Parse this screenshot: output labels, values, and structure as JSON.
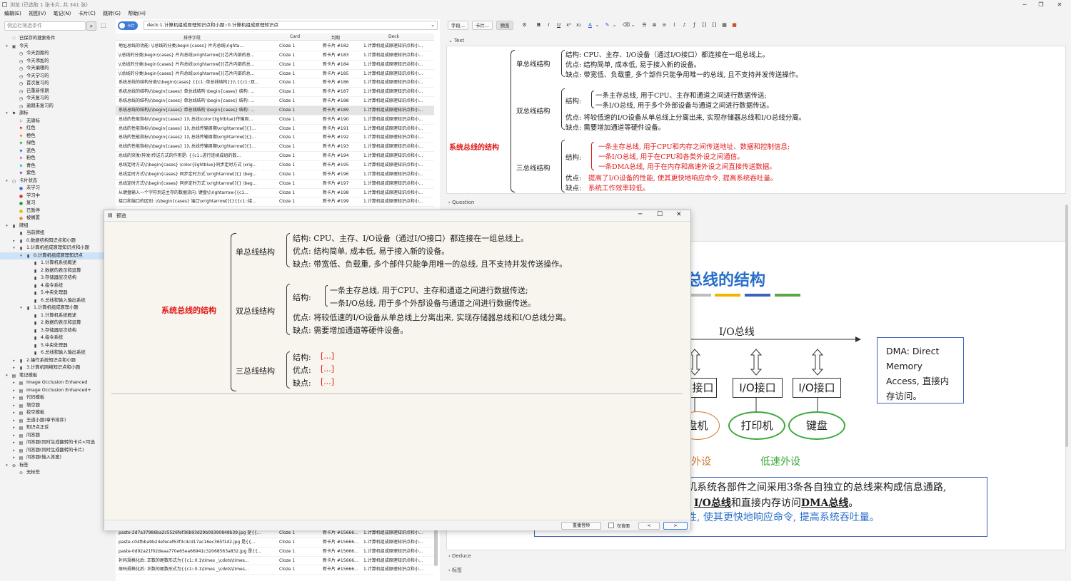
{
  "window": {
    "title": "浏览 (已选取 1 张卡片, 共 341 张)"
  },
  "menu": [
    "编辑(E)",
    "视图(V)",
    "笔记(N)",
    "卡片(C)",
    "跳转(G)",
    "帮助(H)"
  ],
  "sidebar": {
    "search_placeholder": "侧边栏筛选条件",
    "tree": [
      {
        "label": "已保存的搜索条件",
        "icon": "heart-icon",
        "level": 0,
        "arrow": ""
      },
      {
        "label": "今天",
        "icon": "calendar-icon",
        "level": 0,
        "arrow": "▾"
      },
      {
        "label": "今天到期的",
        "icon": "clock-icon",
        "level": 1,
        "arrow": ""
      },
      {
        "label": "今天添加的",
        "icon": "clock-icon",
        "level": 1,
        "arrow": ""
      },
      {
        "label": "今天编辑的",
        "icon": "clock-icon",
        "level": 1,
        "arrow": ""
      },
      {
        "label": "今天学习的",
        "icon": "clock-icon",
        "level": 1,
        "arrow": ""
      },
      {
        "label": "首次复习的",
        "icon": "clock-icon",
        "level": 1,
        "arrow": ""
      },
      {
        "label": "已重新排期",
        "icon": "clock-icon",
        "level": 1,
        "arrow": ""
      },
      {
        "label": "今天复习的",
        "icon": "clock-icon",
        "level": 1,
        "arrow": ""
      },
      {
        "label": "逾期未复习的",
        "icon": "clock-icon",
        "level": 1,
        "arrow": ""
      },
      {
        "label": "旗标",
        "icon": "flag-icon",
        "level": 0,
        "arrow": "▾"
      },
      {
        "label": "无旗标",
        "icon": "flag-off-icon",
        "level": 1,
        "arrow": ""
      },
      {
        "label": "红色",
        "icon": "flag-red-icon",
        "level": 1,
        "arrow": ""
      },
      {
        "label": "橙色",
        "icon": "flag-orange-icon",
        "level": 1,
        "arrow": ""
      },
      {
        "label": "绿色",
        "icon": "flag-green-icon",
        "level": 1,
        "arrow": ""
      },
      {
        "label": "蓝色",
        "icon": "flag-blue-icon",
        "level": 1,
        "arrow": ""
      },
      {
        "label": "粉色",
        "icon": "flag-pink-icon",
        "level": 1,
        "arrow": ""
      },
      {
        "label": "青色",
        "icon": "flag-cyan-icon",
        "level": 1,
        "arrow": ""
      },
      {
        "label": "紫色",
        "icon": "flag-purple-icon",
        "level": 1,
        "arrow": ""
      },
      {
        "label": "卡片状态",
        "icon": "circle-icon",
        "level": 0,
        "arrow": "▾"
      },
      {
        "label": "未学习",
        "icon": "dot-blue-icon",
        "level": 1,
        "arrow": ""
      },
      {
        "label": "学习中",
        "icon": "dot-red-icon",
        "level": 1,
        "arrow": ""
      },
      {
        "label": "复习",
        "icon": "dot-green-icon",
        "level": 1,
        "arrow": ""
      },
      {
        "label": "已暂停",
        "icon": "dot-yellow-icon",
        "level": 1,
        "arrow": ""
      },
      {
        "label": "被搁置",
        "icon": "dot-orange-icon",
        "level": 1,
        "arrow": ""
      },
      {
        "label": "牌组",
        "icon": "deck-icon",
        "level": 0,
        "arrow": "▾"
      },
      {
        "label": "当前牌组",
        "icon": "deck-icon",
        "level": 1,
        "arrow": ""
      },
      {
        "label": "0.数据结构知识点和小题",
        "icon": "deck-icon",
        "level": 1,
        "arrow": "▸"
      },
      {
        "label": "1.计算机组成原理知识点和小题",
        "icon": "deck-icon",
        "level": 1,
        "arrow": "▾"
      },
      {
        "label": "0.计算机组成原理知识点",
        "icon": "deck-icon",
        "level": 2,
        "arrow": "▾",
        "selected": true
      },
      {
        "label": "1.计算机系统概述",
        "icon": "deck-icon",
        "level": 3,
        "arrow": ""
      },
      {
        "label": "2.数据的表示和运算",
        "icon": "deck-icon",
        "level": 3,
        "arrow": ""
      },
      {
        "label": "3.存储器层次结构",
        "icon": "deck-icon",
        "level": 3,
        "arrow": ""
      },
      {
        "label": "4.指令系统",
        "icon": "deck-icon",
        "level": 3,
        "arrow": ""
      },
      {
        "label": "5.中央处理器",
        "icon": "deck-icon",
        "level": 3,
        "arrow": ""
      },
      {
        "label": "6.总线和输入输出系统",
        "icon": "deck-icon",
        "level": 3,
        "arrow": ""
      },
      {
        "label": "1.计算机组成原理小题",
        "icon": "deck-icon",
        "level": 2,
        "arrow": "▾"
      },
      {
        "label": "1.计算机系统概述",
        "icon": "deck-icon",
        "level": 3,
        "arrow": ""
      },
      {
        "label": "2.数据的表示和运算",
        "icon": "deck-icon",
        "level": 3,
        "arrow": ""
      },
      {
        "label": "3.存储器层次结构",
        "icon": "deck-icon",
        "level": 3,
        "arrow": ""
      },
      {
        "label": "4.指令系统",
        "icon": "deck-icon",
        "level": 3,
        "arrow": ""
      },
      {
        "label": "5.中央处理器",
        "icon": "deck-icon",
        "level": 3,
        "arrow": ""
      },
      {
        "label": "6.总线和输入输出系统",
        "icon": "deck-icon",
        "level": 3,
        "arrow": ""
      },
      {
        "label": "2.操作系统知识点和小题",
        "icon": "deck-icon",
        "level": 1,
        "arrow": "▸"
      },
      {
        "label": "3.计算机网络知识点和小题",
        "icon": "deck-icon",
        "level": 1,
        "arrow": "▸"
      },
      {
        "label": "笔记模板",
        "icon": "notetype-icon",
        "level": 0,
        "arrow": "▾"
      },
      {
        "label": "Image Occlusion Enhanced",
        "icon": "notetype-icon",
        "level": 1,
        "arrow": "▸"
      },
      {
        "label": "Image Occlusion Enhanced+",
        "icon": "notetype-icon",
        "level": 1,
        "arrow": "▸"
      },
      {
        "label": "代码模板",
        "icon": "notetype-icon",
        "level": 1,
        "arrow": "▸"
      },
      {
        "label": "填空题",
        "icon": "notetype-icon",
        "level": 1,
        "arrow": "▸"
      },
      {
        "label": "挖空模板",
        "icon": "notetype-icon",
        "level": 1,
        "arrow": "▸"
      },
      {
        "label": "王道小题(章节排序)",
        "icon": "notetype-icon",
        "level": 1,
        "arrow": "▸"
      },
      {
        "label": "知识点正反",
        "icon": "notetype-icon",
        "level": 1,
        "arrow": "▸"
      },
      {
        "label": "问答题",
        "icon": "notetype-icon",
        "level": 1,
        "arrow": "▸"
      },
      {
        "label": "问答题(同时生成翻转的卡片<可选",
        "icon": "notetype-icon",
        "level": 1,
        "arrow": "▸"
      },
      {
        "label": "问答题(同时生成翻转的卡片)",
        "icon": "notetype-icon",
        "level": 1,
        "arrow": "▸"
      },
      {
        "label": "问答题(输入答案)",
        "icon": "notetype-icon",
        "level": 1,
        "arrow": "▸"
      },
      {
        "label": "标签",
        "icon": "tag-icon",
        "level": 0,
        "arrow": "▾"
      },
      {
        "label": "无标签",
        "icon": "tag-off-icon",
        "level": 1,
        "arrow": ""
      }
    ]
  },
  "browser": {
    "toggle_label": "卡片",
    "search_value": "deck:1.计算机组成原理知识点和小题::0.计算机组成原理知识点",
    "columns": [
      "排序字段",
      "Card",
      "到期",
      "Deck"
    ],
    "rows": [
      {
        "sort": "地址总线的功能: \\(总线的分类\\begin{cases} 片内总线\\righta...",
        "card": "Cloze 1",
        "due": "新卡片 #182",
        "deck": "1.计算机组成原理知识点和小..."
      },
      {
        "sort": "\\(总线的分类\\begin{cases} 片内总线\\xrightarrow[]{芯片内部的总...",
        "card": "Cloze 1",
        "due": "新卡片 #183",
        "deck": "1.计算机组成原理知识点和小..."
      },
      {
        "sort": "\\(总线的分类\\begin{cases} 片内总线\\xrightarrow[]{芯片内部的总...",
        "card": "Cloze 1",
        "due": "新卡片 #184",
        "deck": "1.计算机组成原理知识点和小..."
      },
      {
        "sort": "\\(总线的分类\\begin{cases} 片内总线\\xrightarrow[]{芯片内部的总...",
        "card": "Cloze 1",
        "due": "新卡片 #185",
        "deck": "1.计算机组成原理知识点和小..."
      },
      {
        "sort": "系统总线的结构分类\\(\\begin{cases} {{c1::单总线结构}}\\\\ {{c1::双...",
        "card": "Cloze 1",
        "due": "新卡片 #186",
        "deck": "1.计算机组成原理知识点和小..."
      },
      {
        "sort": "系统总线的结构\\(\\begin{cases} 单总线结构 \\begin{cases} 结构: ...",
        "card": "Cloze 1",
        "due": "新卡片 #187",
        "deck": "1.计算机组成原理知识点和小..."
      },
      {
        "sort": "系统总线的结构\\(\\begin{cases} 单总线结构 \\begin{cases} 结构: ...",
        "card": "Cloze 1",
        "due": "新卡片 #188",
        "deck": "1.计算机组成原理知识点和小..."
      },
      {
        "sort": "系统总线的结构\\(\\begin{cases} 单总线结构 \\begin{cases} 结构: ...",
        "card": "Cloze 1",
        "due": "新卡片 #189",
        "deck": "1.计算机组成原理知识点和小...",
        "selected": true
      },
      {
        "sort": "总线的性能指标\\(\\begin{cases} 1)\\ 总线\\color{lightblue}传输周...",
        "card": "Cloze 1",
        "due": "新卡片 #190",
        "deck": "1.计算机组成原理知识点和小..."
      },
      {
        "sort": "总线的性能指标\\(\\begin{cases} 1)\\ 总线传输周期\\xrightarrow[]{}...",
        "card": "Cloze 1",
        "due": "新卡片 #191",
        "deck": "1.计算机组成原理知识点和小..."
      },
      {
        "sort": "总线的性能指标\\(\\begin{cases} 1)\\ 总线传输周期\\xrightarrow[]{}...",
        "card": "Cloze 1",
        "due": "新卡片 #192",
        "deck": "1.计算机组成原理知识点和小..."
      },
      {
        "sort": "总线的性能指标\\(\\begin{cases} 1)\\ 总线传输周期\\xrightarrow[]{}...",
        "card": "Cloze 1",
        "due": "新卡片 #193",
        "deck": "1.计算机组成原理知识点和小..."
      },
      {
        "sort": "总线的突发(猝发)传送方式的作用是: {{c1::进行连续成组的数...",
        "card": "Cloze 1",
        "due": "新卡片 #194",
        "deck": "1.计算机组成原理知识点和小..."
      },
      {
        "sort": "总线定时方式\\(\\begin{cases} \\color{lightblue}同步定时方式 \\xrig...",
        "card": "Cloze 1",
        "due": "新卡片 #195",
        "deck": "1.计算机组成原理知识点和小..."
      },
      {
        "sort": "总线定时方式\\(\\begin{cases} 同步定时方式 \\xrightarrow[]{} \\beg...",
        "card": "Cloze 1",
        "due": "新卡片 #196",
        "deck": "1.计算机组成原理知识点和小..."
      },
      {
        "sort": "总线定时方式\\(\\begin{cases} 同步定时方式 \\xrightarrow[]{} \\beg...",
        "card": "Cloze 1",
        "due": "新卡片 #197",
        "deck": "1.计算机组成原理知识点和小..."
      },
      {
        "sort": "从键盘输入一个字符到送主存的数据流向: 键盘\\(\\rightarrow{{c1...",
        "card": "Cloze 1",
        "due": "新卡片 #198",
        "deck": "1.计算机组成原理知识点和小..."
      },
      {
        "sort": "接口和端口的区别: \\(\\begin{cases} 端口\\xrightarrow[]{}{{c1::接...",
        "card": "Cloze 1",
        "due": "新卡片 #199",
        "deck": "1.计算机组成原理知识点和小..."
      }
    ],
    "rows_bottom": [
      {
        "sort": "paste-2d7a37986ba2c5526fef36b93d29b09390848b39.jpg 是{{...",
        "card": "Cloze 1",
        "due": "新卡片 #15666...",
        "deck": "1.计算机组成原理知识点和小..."
      },
      {
        "sort": "paste-c04fbba9b24efecef63f3c4cd17ac16ec365f1d2.jpg 是{{...",
        "card": "Cloze 1",
        "due": "新卡片 #15666...",
        "deck": "1.计算机组成原理知识点和小..."
      },
      {
        "sort": "paste-0d92a21f02deaa770e65ea66941c32068563a832.jpg 是{{...",
        "card": "Cloze 1",
        "due": "新卡片 #15666...",
        "deck": "1.计算机组成原理知识点和小..."
      },
      {
        "sort": "补码规格化后: 正数的尾数形式为{{c1::0.1\\times _\\cdots\\times...",
        "card": "Cloze 1",
        "due": "新卡片 #15666...",
        "deck": "1.计算机组成原理知识点和小..."
      },
      {
        "sort": "原码规格化后: 正数的尾数形式为{{c1::0.1\\times _\\cdots\\times...",
        "card": "Cloze 1",
        "due": "新卡片 #15666...",
        "deck": "1.计算机组成原理知识点和小..."
      }
    ]
  },
  "editor": {
    "toolbar": {
      "fields_btn": "字段...",
      "cards_btn": "卡片...",
      "preview_btn": "预览"
    },
    "fields": {
      "text": "Text",
      "question": "Question",
      "deduce": "Deduce",
      "tags": "标签"
    },
    "mindmap": {
      "root": "系统总线的结构",
      "single": {
        "name": "单总线结构",
        "structure": "结构: CPU、主存、I/O设备（通过I/O接口）都连接在一组总线上。",
        "pros": "优点: 结构简单, 成本低, 易于接入新的设备。",
        "cons": "缺点: 带宽低、负载重, 多个部件只能争用唯一的总线, 且不支持并发传送操作。"
      },
      "double": {
        "name": "双总线结构",
        "structure_label": "结构:",
        "s1": "一条主存总线, 用于CPU、主存和通道之间进行数据传送;",
        "s2": "一条I/O总线, 用于多个外部设备与通道之间进行数据传送。",
        "pros": "优点: 将较低速的I/O设备从单总线上分离出来, 实现存储器总线和I/O总线分离。",
        "cons": "缺点: 需要增加通道等硬件设备。"
      },
      "triple": {
        "name": "三总线结构",
        "structure_label": "结构:",
        "s1": "一条主存总线, 用于CPU和内存之间传送地址、数据和控制信息;",
        "s2": "一条I/O总线, 用于在CPU和各类外设之间通信。",
        "s3": "一条DMA总线, 用于在内存和高速外设之间直接传送数据。",
        "pros_label": "优点:",
        "pros": "提高了I/O设备的性能, 使其更快地响应命令, 提高系统吞吐量。",
        "cons_label": "缺点:",
        "cons": "系统工作效率较低。",
        "hidden_structure": "结构:",
        "hidden_pros": "优点:",
        "hidden_cons": "缺点:",
        "placeholder": "[...]"
      }
    },
    "image": {
      "title": "总线的结构",
      "bus_label": "I/O总线",
      "io1": "接口",
      "io2": "I/O接口",
      "io3": "I/O接口",
      "dev1": "盘机",
      "dev2": "打印机",
      "dev3": "键盘",
      "lowspeed1": "外设",
      "lowspeed2": "低速外设",
      "dma_note": "DMA: Direct Memory Access, 直接内存访问。",
      "desc1": "机系统各部件之间采用3条各自独立的总线来构成信息通路,",
      "desc2_a": "I/O总线",
      "desc2_b": "和直接内存访问",
      "desc2_c": "DMA总线",
      "desc2_d": "。",
      "desc3": "性, 使其更快地响应命令, 提高系统吞吐量。"
    }
  },
  "preview": {
    "title": "预览",
    "replay_btn": "重播音频",
    "back_only": "仅背面",
    "prev": "<",
    "next": ">"
  }
}
